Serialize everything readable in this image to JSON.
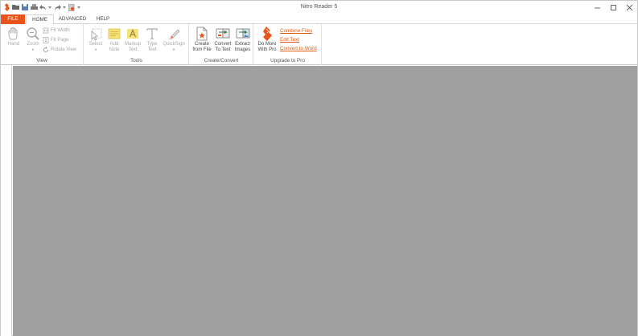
{
  "app": {
    "title": "Nitro Reader 5"
  },
  "tabs": {
    "file": "FILE",
    "home": "HOME",
    "advanced": "ADVANCED",
    "help": "HELP"
  },
  "ribbon": {
    "view": {
      "label": "View",
      "hand": "Hand",
      "zoom": "Zoom",
      "fit_width": "Fit Width",
      "fit_page": "Fit Page",
      "rotate_view": "Rotate View"
    },
    "tools": {
      "label": "Tools",
      "select": "Select",
      "add_note_1": "Add",
      "add_note_2": "Note",
      "markup_1": "Markup",
      "markup_2": "Text",
      "type_1": "Type",
      "type_2": "Text",
      "quicksign": "QuickSign"
    },
    "create": {
      "label": "Create/Convert",
      "create_1": "Create",
      "create_2": "from File",
      "convert_1": "Convert",
      "convert_2": "To Text",
      "extract_1": "Extract",
      "extract_2": "Images"
    },
    "upgrade": {
      "label": "Upgrade to Pro",
      "domore_1": "Do More",
      "domore_2": "With Pro",
      "combine": "Combine Files",
      "edit": "Edit Text",
      "convert_word": "Convert to Word"
    }
  },
  "colors": {
    "accent": "#e9541a",
    "link": "#e15a12",
    "doc_bg": "#a0a0a0"
  }
}
